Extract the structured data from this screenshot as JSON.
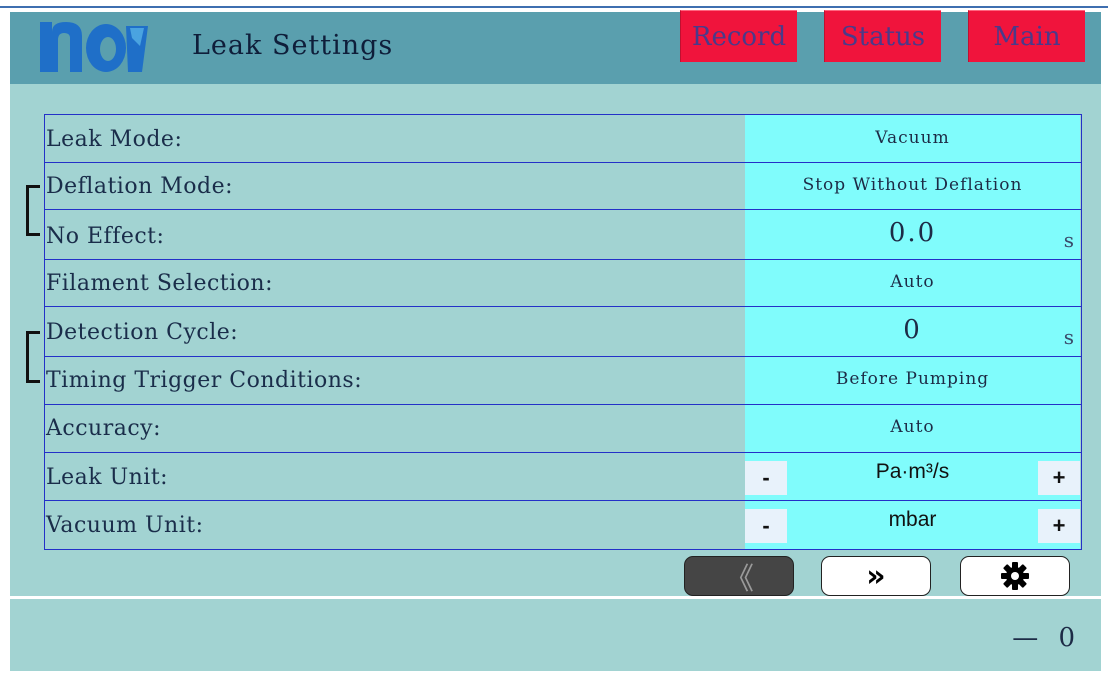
{
  "header": {
    "title": "Leak Settings",
    "logo_icon": "nai-logo",
    "colors": {
      "header_bg": "#5a9fae",
      "nav_button_bg": "#f0143c",
      "nav_button_text": "#4a3a8a"
    }
  },
  "nav": {
    "record_label": "Record",
    "status_label": "Status",
    "main_label": "Main"
  },
  "settings": {
    "colors": {
      "panel_bg": "#a2d3d2",
      "value_bg": "#80fcfc",
      "grid_line": "#2430c8"
    },
    "rows": [
      {
        "label": "Leak Mode:",
        "value": "Vacuum"
      },
      {
        "label": "Deflation Mode:",
        "value": "Stop Without Deflation"
      },
      {
        "label": "No Effect:",
        "value": "0.0",
        "unit": "s"
      },
      {
        "label": "Filament Selection:",
        "value": "Auto"
      },
      {
        "label": "Detection Cycle:",
        "value": "0",
        "unit": "s"
      },
      {
        "label": "Timing Trigger Conditions:",
        "value": "Before Pumping"
      },
      {
        "label": "Accuracy:",
        "value": "Auto"
      },
      {
        "label": "Leak Unit:",
        "value": "Pa·m³/s",
        "minus": "-",
        "plus": "+"
      },
      {
        "label": "Vacuum Unit:",
        "value": "mbar",
        "minus": "-",
        "plus": "+"
      }
    ]
  },
  "pager": {
    "prev_icon": "double-chevron-left-icon",
    "prev_label": "《",
    "next_icon": "double-chevron-right-icon",
    "next_label": "»",
    "settings_icon": "gear-icon"
  },
  "footer": {
    "readout": "— 0"
  }
}
